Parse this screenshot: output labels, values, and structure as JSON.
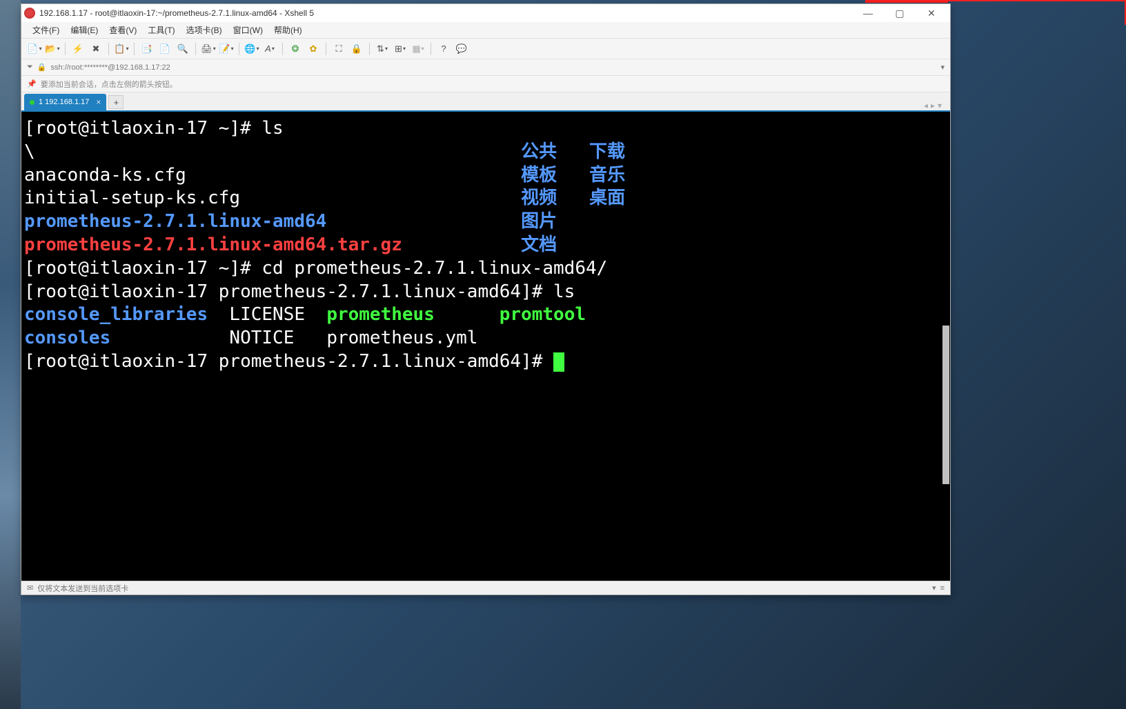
{
  "window": {
    "title": "192.168.1.17 - root@itlaoxin-17:~/prometheus-2.7.1.linux-amd64 - Xshell 5"
  },
  "menubar": {
    "items": [
      "文件(F)",
      "编辑(E)",
      "查看(V)",
      "工具(T)",
      "选项卡(B)",
      "窗口(W)",
      "帮助(H)"
    ]
  },
  "addressbar": {
    "text": "ssh://root:********@192.168.1.17:22"
  },
  "hintbar": {
    "text": "要添加当前会话，点击左侧的箭头按钮。"
  },
  "tab": {
    "label": "1 192.168.1.17"
  },
  "terminal": {
    "prompt1": "[root@itlaoxin-17 ~]# ",
    "cmd1": "ls",
    "ls1": {
      "backslash": "\\",
      "anaconda": "anaconda-ks.cfg",
      "initial": "initial-setup-ks.cfg",
      "promdir": "prometheus-2.7.1.linux-amd64",
      "promtar": "prometheus-2.7.1.linux-amd64.tar.gz",
      "cn_public": "公共",
      "cn_download": "下载",
      "cn_template": "模板",
      "cn_music": "音乐",
      "cn_video": "视频",
      "cn_desktop": "桌面",
      "cn_picture": "图片",
      "cn_document": "文档"
    },
    "prompt2": "[root@itlaoxin-17 ~]# ",
    "cmd2": "cd prometheus-2.7.1.linux-amd64/",
    "prompt3": "[root@itlaoxin-17 prometheus-2.7.1.linux-amd64]# ",
    "cmd3": "ls",
    "ls2": {
      "console_libraries": "console_libraries",
      "license": "LICENSE",
      "prometheus_bin": "prometheus",
      "promtool": "promtool",
      "consoles": "consoles",
      "notice": "NOTICE",
      "prometheus_yml": "prometheus.yml"
    },
    "prompt4": "[root@itlaoxin-17 prometheus-2.7.1.linux-amd64]# "
  },
  "statusbar": {
    "text": "仅将文本发送到当前选项卡"
  }
}
